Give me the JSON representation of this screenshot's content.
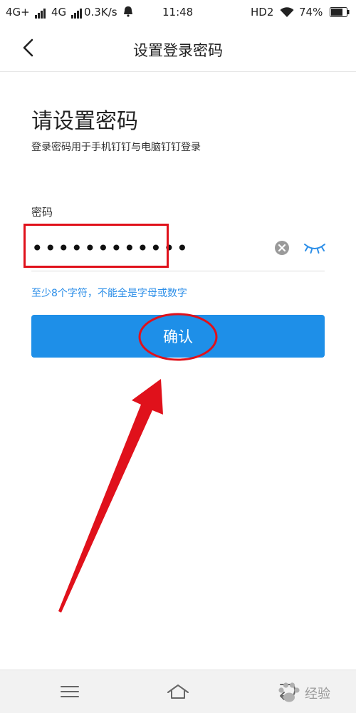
{
  "status_bar": {
    "network1": "4G+",
    "network2": "4G",
    "speed": "0.3K/s",
    "time": "11:48",
    "hd": "HD2",
    "battery": "74%"
  },
  "header": {
    "title": "设置登录密码"
  },
  "main": {
    "title": "请设置密码",
    "subtitle": "登录密码用于手机钉钉与电脑钉钉登录",
    "field_label": "密码",
    "password_value": "••••••••••••",
    "hint": "至少8个字符，不能全是字母或数字",
    "confirm_label": "确认"
  },
  "watermark": {
    "text": "经验"
  },
  "colors": {
    "accent": "#1e8fe8",
    "hint": "#2b8ee8",
    "annotation": "#e0111b"
  },
  "icons": {
    "back": "chevron-left-icon",
    "clear": "clear-circle-icon",
    "eye": "eye-closed-icon",
    "menu": "menu-icon",
    "home": "home-icon",
    "back_nav": "back-nav-icon"
  }
}
